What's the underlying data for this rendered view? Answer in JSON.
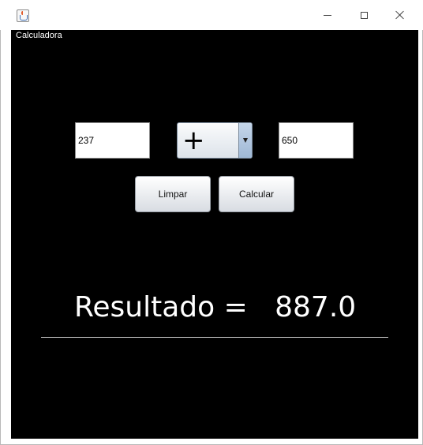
{
  "window": {
    "icon": "java-cup-icon",
    "controls": {
      "minimize": "minimize-icon",
      "maximize": "maximize-icon",
      "close": "close-icon"
    }
  },
  "app": {
    "title": "Calculadora"
  },
  "inputs": {
    "first_value": "237",
    "second_value": "650"
  },
  "operator": {
    "selected": "+"
  },
  "buttons": {
    "clear": "Limpar",
    "calculate": "Calcular"
  },
  "result": {
    "text": "Resultado =   887.0"
  },
  "colors": {
    "background": "#000000",
    "text": "#ffffff"
  }
}
